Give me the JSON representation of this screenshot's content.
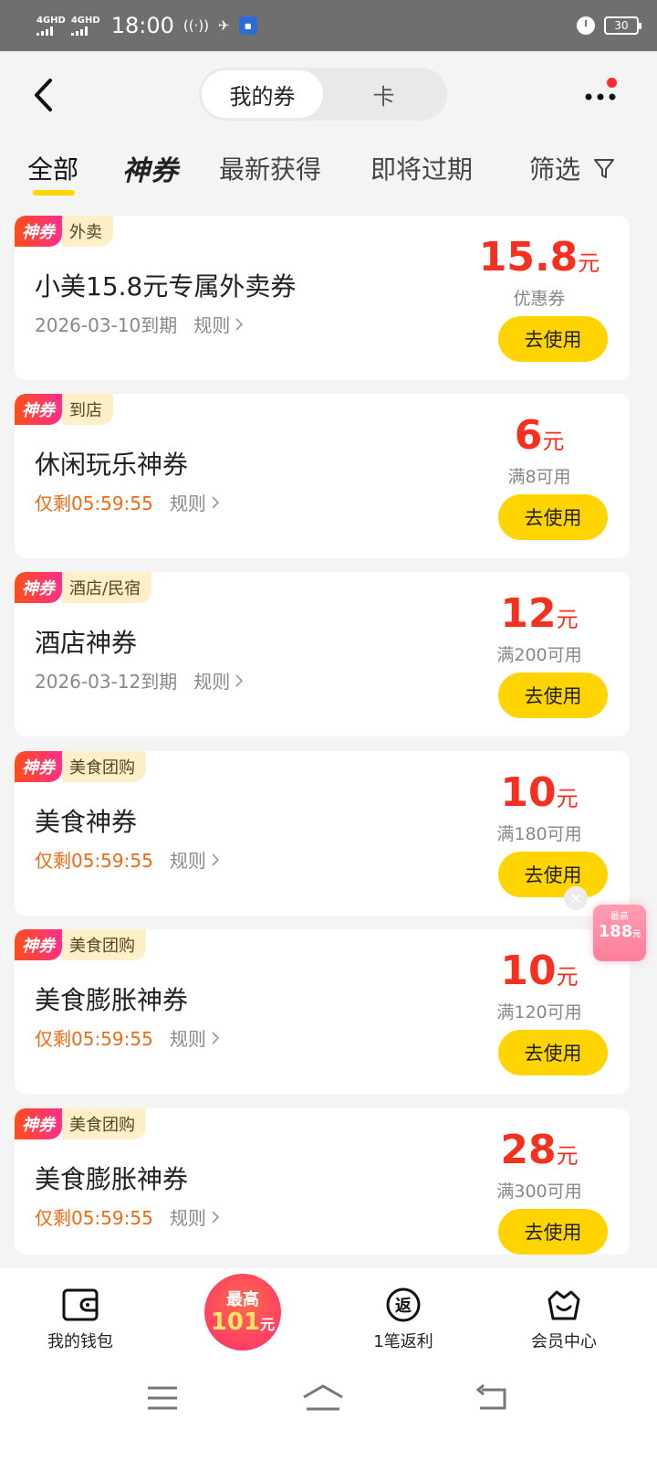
{
  "status_bar": {
    "sim1": "4GHD",
    "sim2": "4GHD",
    "time": "18:00",
    "battery": "30"
  },
  "header": {
    "segment": [
      "我的券",
      "卡"
    ]
  },
  "tabs": {
    "all": "全部",
    "shenquan": "神券",
    "newest": "最新获得",
    "expiring": "即将过期",
    "filter": "筛选"
  },
  "coupons": [
    {
      "badge": "神券",
      "category": "外卖",
      "title": "小美15.8元专属外卖券",
      "expiry": "2026-03-10到期",
      "expiry_warn": false,
      "rules": "规则",
      "amount": "15.8",
      "unit": "元",
      "condition": "优惠券",
      "button": "去使用"
    },
    {
      "badge": "神券",
      "category": "到店",
      "title": "休闲玩乐神券",
      "expiry": "仅剩05:59:55",
      "expiry_warn": true,
      "rules": "规则",
      "amount": "6",
      "unit": "元",
      "condition": "满8可用",
      "button": "去使用"
    },
    {
      "badge": "神券",
      "category": "酒店/民宿",
      "title": "酒店神券",
      "expiry": "2026-03-12到期",
      "expiry_warn": false,
      "rules": "规则",
      "amount": "12",
      "unit": "元",
      "condition": "满200可用",
      "button": "去使用"
    },
    {
      "badge": "神券",
      "category": "美食团购",
      "title": "美食神券",
      "expiry": "仅剩05:59:55",
      "expiry_warn": true,
      "rules": "规则",
      "amount": "10",
      "unit": "元",
      "condition": "满180可用",
      "button": "去使用"
    },
    {
      "badge": "神券",
      "category": "美食团购",
      "title": "美食膨胀神券",
      "expiry": "仅剩05:59:55",
      "expiry_warn": true,
      "rules": "规则",
      "amount": "10",
      "unit": "元",
      "condition": "满120可用",
      "button": "去使用"
    },
    {
      "badge": "神券",
      "category": "美食团购",
      "title": "美食膨胀神券",
      "expiry": "仅剩05:59:55",
      "expiry_warn": true,
      "rules": "规则",
      "amount": "28",
      "unit": "元",
      "condition": "满300可用",
      "button": "去使用"
    }
  ],
  "float_promo": {
    "top": "最高",
    "value": "188",
    "unit": "元"
  },
  "bottom_nav": {
    "wallet": "我的钱包",
    "promo_top": "最高",
    "promo_value": "101",
    "promo_unit": "元",
    "rebate": "1笔返利",
    "rebate_icon_text": "返",
    "member": "会员中心"
  },
  "colors": {
    "accent_yellow": "#ffd400",
    "price_red": "#f5301f",
    "warn_orange": "#f06a14"
  }
}
